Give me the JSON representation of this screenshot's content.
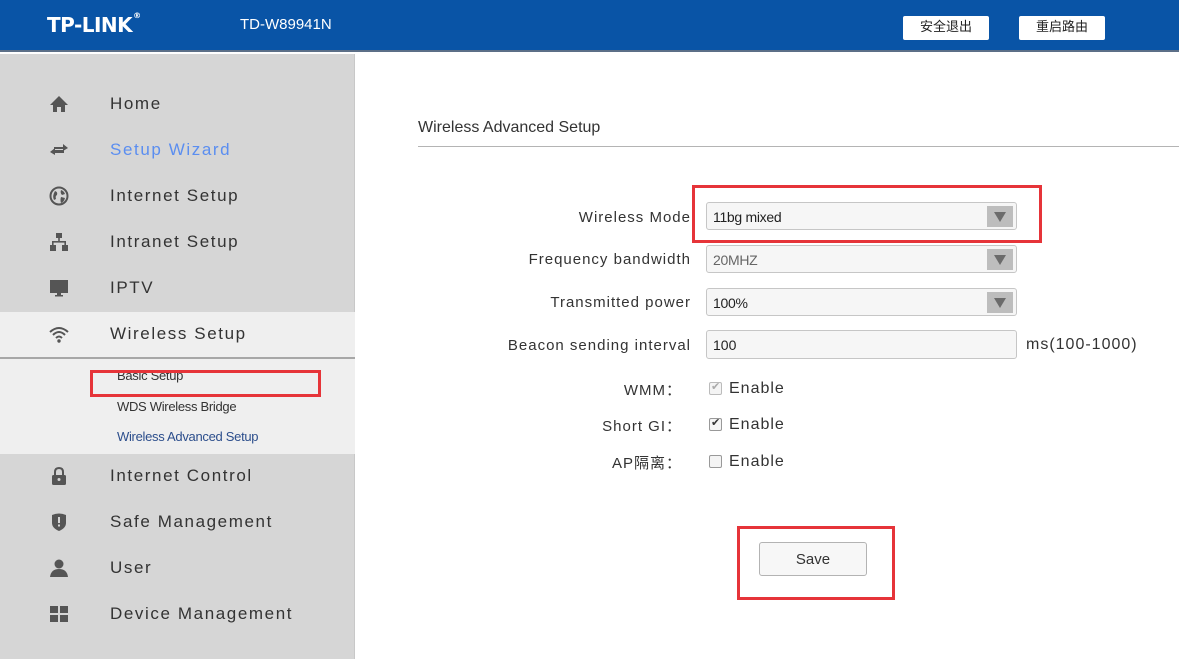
{
  "header": {
    "brand": "TP-LINK",
    "brand_mark": "®",
    "model": "TD-W89941N",
    "logout_label": "安全退出",
    "reboot_label": "重启路由"
  },
  "sidebar": {
    "items": [
      {
        "label": "Home",
        "icon": "home-icon"
      },
      {
        "label": "Setup Wizard",
        "icon": "swap-arrows-icon"
      },
      {
        "label": "Internet Setup",
        "icon": "globe-icon"
      },
      {
        "label": "Intranet Setup",
        "icon": "network-tree-icon"
      },
      {
        "label": "IPTV",
        "icon": "monitor-icon"
      },
      {
        "label": "Wireless Setup",
        "icon": "wifi-icon"
      },
      {
        "label": "Internet Control",
        "icon": "lock-icon"
      },
      {
        "label": "Safe Management",
        "icon": "shield-icon"
      },
      {
        "label": "User",
        "icon": "user-icon"
      },
      {
        "label": "Device Management",
        "icon": "grid-icon"
      }
    ],
    "submenu": [
      {
        "label": "Basic Setup"
      },
      {
        "label": "WDS Wireless Bridge"
      },
      {
        "label": "Wireless Advanced Setup"
      }
    ]
  },
  "main": {
    "title": "Wireless Advanced Setup",
    "fields": {
      "wireless_mode": {
        "label": "Wireless Mode",
        "value": "11bg mixed"
      },
      "frequency_bandwidth": {
        "label": "Frequency bandwidth",
        "value": "20MHZ"
      },
      "transmitted_power": {
        "label": "Transmitted power",
        "value": "100%"
      },
      "beacon_interval": {
        "label": "Beacon sending interval",
        "value": "100",
        "unit": "ms(100-1000)"
      },
      "wmm": {
        "label": "WMM：",
        "option": "Enable",
        "checked": true,
        "disabled": true
      },
      "short_gi": {
        "label": "Short GI：",
        "option": "Enable",
        "checked": true
      },
      "ap_isolation": {
        "label": "AP隔离：",
        "option": "Enable",
        "checked": false
      }
    },
    "save_label": "Save"
  },
  "colors": {
    "header_bg": "#0954a6",
    "sidebar_bg": "#d6d6d6",
    "link_blue": "#5b8ef0",
    "highlight_red": "#e63439"
  }
}
